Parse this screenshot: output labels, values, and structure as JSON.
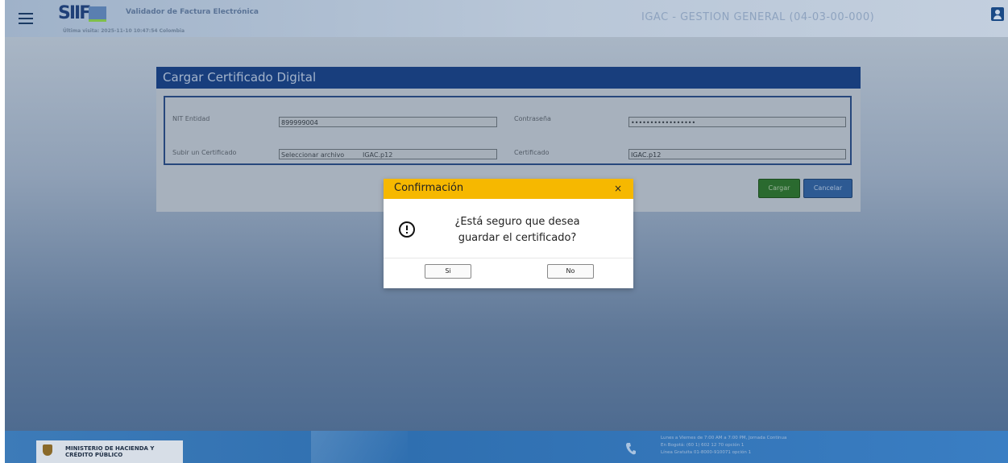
{
  "header": {
    "logo_text": "SIIF",
    "app_title": "Validador de Factura Electrónica",
    "last_visit": "Última visita: 2025-11-10 10:47:54 Colombia",
    "entity": "IGAC - GESTION GENERAL (04-03-00-000)",
    "icons": {
      "menu": "menu-icon",
      "user": "user-icon"
    }
  },
  "card": {
    "title": "Cargar Certificado Digital",
    "fields": {
      "nit_label": "NIT Entidad",
      "nit_value": "899999004",
      "password_label": "Contraseña",
      "password_value": "•••••••••••••••••",
      "upload_label": "Subir un Certificado",
      "file_button": "Seleccionar archivo",
      "file_name": "IGAC.p12",
      "certificate_label": "Certificado",
      "certificate_value": "IGAC.p12"
    },
    "buttons": {
      "cargar": "Cargar",
      "cancelar": "Cancelar"
    }
  },
  "modal": {
    "title": "Confirmación",
    "close": "×",
    "message_line1": "¿Está seguro que desea",
    "message_line2": "guardar el certificado?",
    "yes": "Si",
    "no": "No",
    "icon": "alert-circle-icon"
  },
  "footer": {
    "ministry_line1": "MINISTERIO DE HACIENDA Y",
    "ministry_line2": "CRÉDITO PÚBLICO",
    "hours": "Lunes a Viernes de 7:00 AM a 7:00 PM, Jornada Continua",
    "bogota": "En Bogotá: (60 1) 602 12 70 opción 1",
    "free_line": "Línea Gratuita 01-8000-910071 opción 1",
    "icons": {
      "phone": "phone-icon",
      "seal": "coat-of-arms-icon"
    }
  },
  "colors": {
    "header_bg": "#b9c7d8",
    "title_bar": "#183e7d",
    "modal_header": "#f6b800",
    "cargar_button": "#2a6a2f",
    "cancelar_button": "#2d5a93",
    "footer_bg": "#2f6fb0"
  }
}
